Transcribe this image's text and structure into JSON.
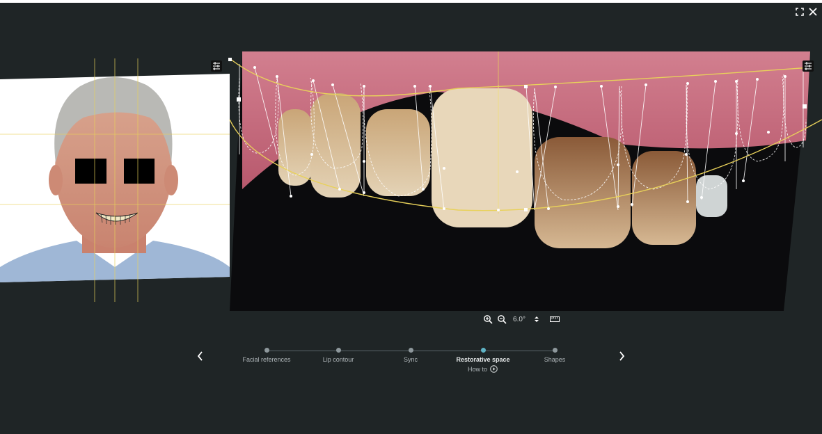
{
  "window": {
    "fullscreen_icon": "fullscreen-icon",
    "close_icon": "close-icon"
  },
  "zoom": {
    "value": "6.0°",
    "zoom_in_icon": "zoom-in-icon",
    "zoom_out_icon": "zoom-out-icon",
    "stepper_icon": "up-down-icon",
    "ruler_icon": "ruler-icon"
  },
  "steps": [
    {
      "label": "Facial references",
      "active": false
    },
    {
      "label": "Lip contour",
      "active": false
    },
    {
      "label": "Sync",
      "active": false
    },
    {
      "label": "Restorative space",
      "active": true
    },
    {
      "label": "Shapes",
      "active": false
    }
  ],
  "howto": {
    "label": "How to",
    "icon": "play-circle-icon"
  },
  "colors": {
    "background": "#1f2526",
    "accent_step": "#5fb3c5",
    "guide_yellow": "#e8d15a",
    "guide_white": "#ffffff"
  }
}
